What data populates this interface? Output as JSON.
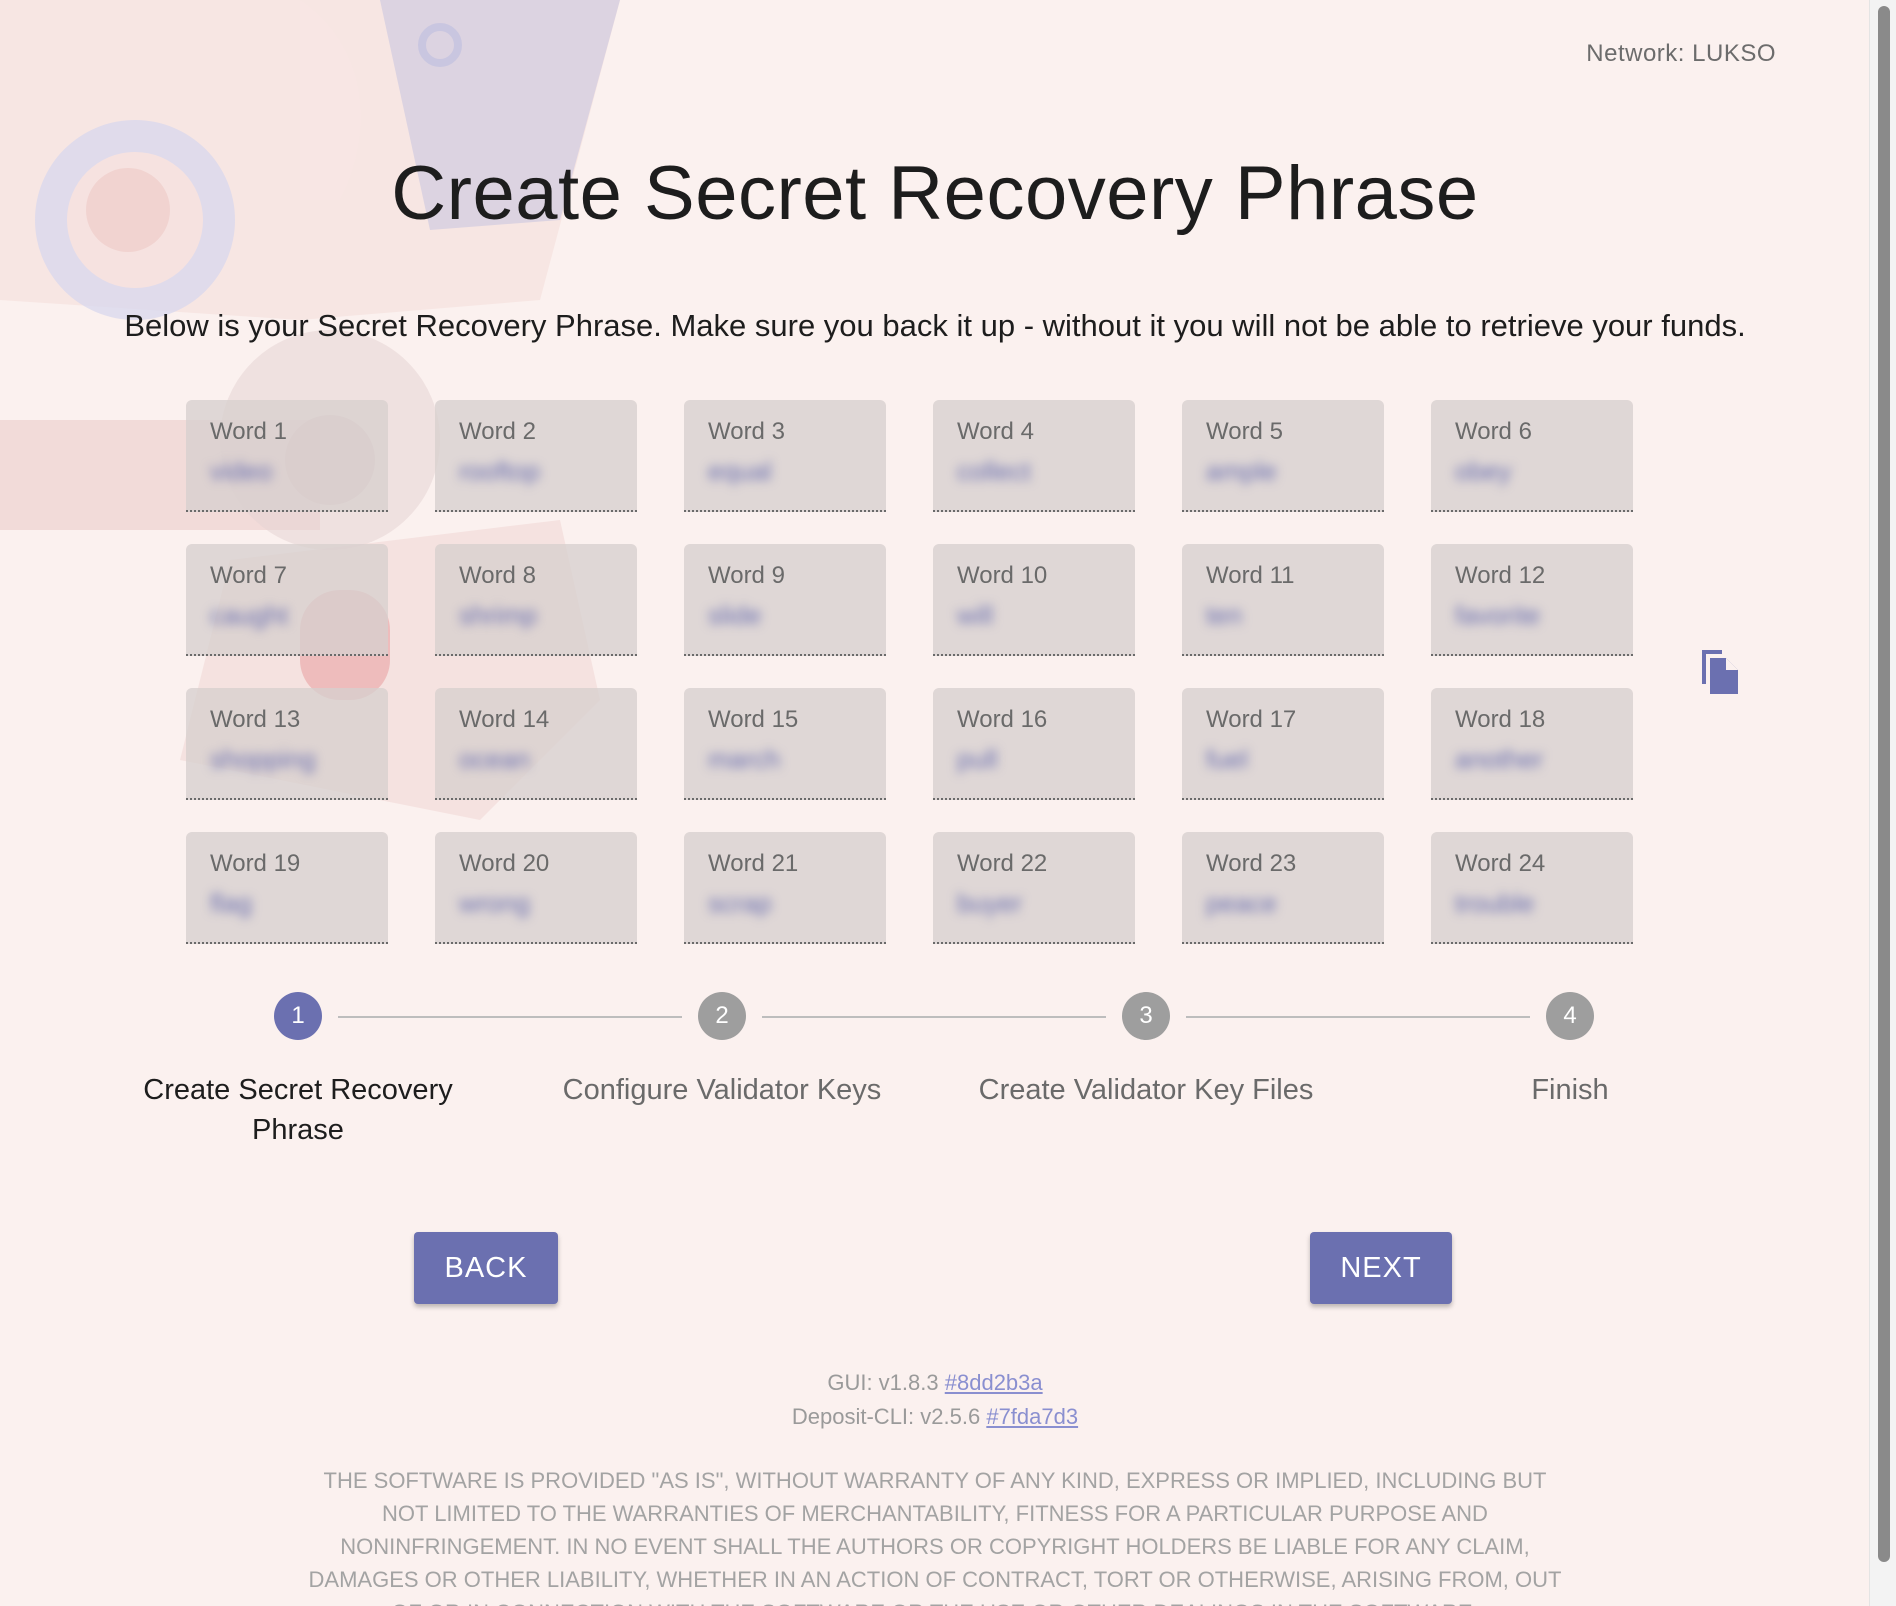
{
  "header": {
    "network_label": "Network: LUKSO"
  },
  "main": {
    "title": "Create Secret Recovery Phrase",
    "subtitle": "Below is your Secret Recovery Phrase. Make sure you back it up - without it you will not be able to retrieve your funds."
  },
  "words": [
    {
      "label": "Word 1",
      "value": "video"
    },
    {
      "label": "Word 2",
      "value": "rooftop"
    },
    {
      "label": "Word 3",
      "value": "equal"
    },
    {
      "label": "Word 4",
      "value": "collect"
    },
    {
      "label": "Word 5",
      "value": "ample"
    },
    {
      "label": "Word 6",
      "value": "obey"
    },
    {
      "label": "Word 7",
      "value": "caught"
    },
    {
      "label": "Word 8",
      "value": "shrimp"
    },
    {
      "label": "Word 9",
      "value": "slide"
    },
    {
      "label": "Word 10",
      "value": "will"
    },
    {
      "label": "Word 11",
      "value": "ten"
    },
    {
      "label": "Word 12",
      "value": "favorite"
    },
    {
      "label": "Word 13",
      "value": "shopping"
    },
    {
      "label": "Word 14",
      "value": "ocean"
    },
    {
      "label": "Word 15",
      "value": "march"
    },
    {
      "label": "Word 16",
      "value": "pull"
    },
    {
      "label": "Word 17",
      "value": "fuel"
    },
    {
      "label": "Word 18",
      "value": "another"
    },
    {
      "label": "Word 19",
      "value": "flag"
    },
    {
      "label": "Word 20",
      "value": "wrong"
    },
    {
      "label": "Word 21",
      "value": "scrap"
    },
    {
      "label": "Word 22",
      "value": "buyer"
    },
    {
      "label": "Word 23",
      "value": "peace"
    },
    {
      "label": "Word 24",
      "value": "trouble"
    }
  ],
  "copy_icon": "copy-icon",
  "stepper": {
    "steps": [
      {
        "number": "1",
        "label": "Create Secret Recovery Phrase",
        "active": true
      },
      {
        "number": "2",
        "label": "Configure Validator Keys",
        "active": false
      },
      {
        "number": "3",
        "label": "Create Validator Key Files",
        "active": false
      },
      {
        "number": "4",
        "label": "Finish",
        "active": false
      }
    ]
  },
  "buttons": {
    "back_label": "BACK",
    "next_label": "NEXT"
  },
  "footer": {
    "gui_label": "GUI: v1.8.3",
    "gui_hash": "#8dd2b3a",
    "cli_label": "Deposit-CLI: v2.5.6",
    "cli_hash": "#7fda7d3",
    "license": "THE SOFTWARE IS PROVIDED \"AS IS\", WITHOUT WARRANTY OF ANY KIND, EXPRESS OR IMPLIED, INCLUDING BUT NOT LIMITED TO THE WARRANTIES OF MERCHANTABILITY, FITNESS FOR A PARTICULAR PURPOSE AND NONINFRINGEMENT. IN NO EVENT SHALL THE AUTHORS OR COPYRIGHT HOLDERS BE LIABLE FOR ANY CLAIM, DAMAGES OR OTHER LIABILITY, WHETHER IN AN ACTION OF CONTRACT, TORT OR OTHERWISE, ARISING FROM, OUT OF OR IN CONNECTION WITH THE SOFTWARE OR THE USE OR OTHER DEALINGS IN THE SOFTWARE."
  },
  "colors": {
    "accent": "#6b70b0",
    "background": "#fbf1ef",
    "inactive_step": "#9e9e9e"
  }
}
